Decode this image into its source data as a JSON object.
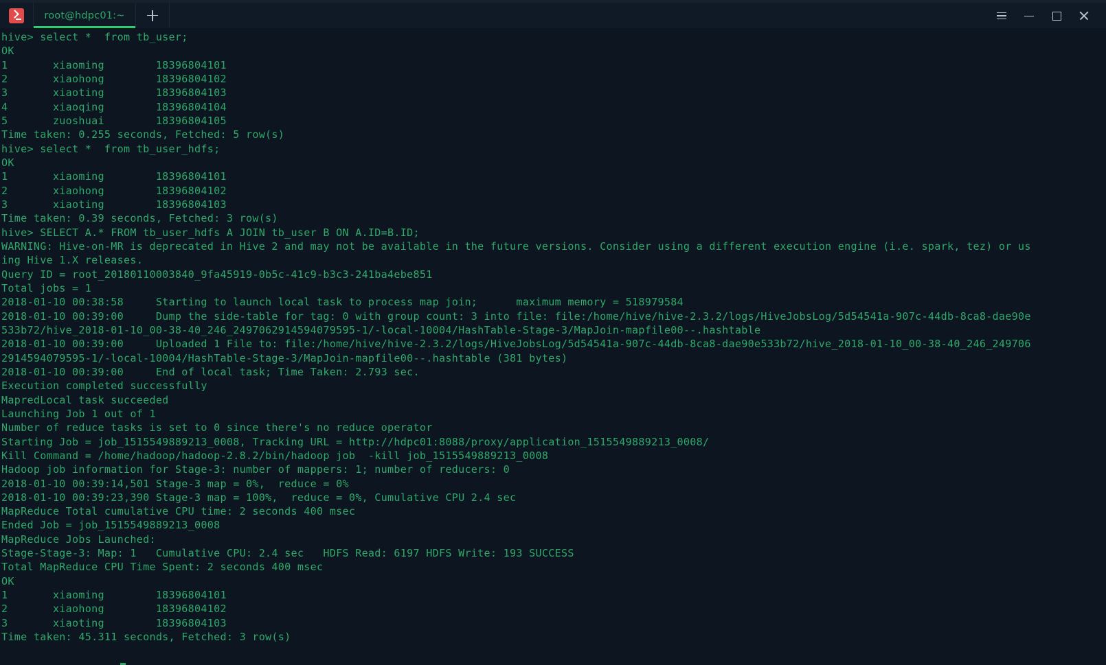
{
  "window": {
    "title": "root@hdpc01:~",
    "icon": "terminal-icon",
    "controls": {
      "menu_label": "☰",
      "minimize_label": "—",
      "maximize_label": "□",
      "close_label": "✕"
    },
    "new_tab_label": "+"
  },
  "tabs": [
    {
      "label": "root@hdpc01:~",
      "active": true
    }
  ],
  "colors": {
    "window_background": "#101a26",
    "terminal_background": "#0d1620",
    "terminal_foreground": "#2fa86a",
    "tab_active_underline": "#2ecc71",
    "tab_label": "#2fa86a",
    "icon_badge": "#e14b4b",
    "control_glyph": "#b9c3cc"
  },
  "terminal": {
    "prompt": "hive>",
    "cursor_visible": true,
    "lines": [
      "hive> select *  from tb_user;",
      "OK",
      "1       xiaoming        18396804101",
      "2       xiaohong        18396804102",
      "3       xiaoting        18396804103",
      "4       xiaoqing        18396804104",
      "5       zuoshuai        18396804105",
      "Time taken: 0.255 seconds, Fetched: 5 row(s)",
      "hive> select *  from tb_user_hdfs;",
      "OK",
      "1       xiaoming        18396804101",
      "2       xiaohong        18396804102",
      "3       xiaoting        18396804103",
      "Time taken: 0.39 seconds, Fetched: 3 row(s)",
      "hive> SELECT A.* FROM tb_user_hdfs A JOIN tb_user B ON A.ID=B.ID;",
      "WARNING: Hive-on-MR is deprecated in Hive 2 and may not be available in the future versions. Consider using a different execution engine (i.e. spark, tez) or us",
      "ing Hive 1.X releases.",
      "Query ID = root_20180110003840_9fa45919-0b5c-41c9-b3c3-241ba4ebe851",
      "Total jobs = 1",
      "2018-01-10 00:38:58     Starting to launch local task to process map join;      maximum memory = 518979584",
      "2018-01-10 00:39:00     Dump the side-table for tag: 0 with group count: 3 into file: file:/home/hive/hive-2.3.2/logs/HiveJobsLog/5d54541a-907c-44db-8ca8-dae90e",
      "533b72/hive_2018-01-10_00-38-40_246_2497062914594079595-1/-local-10004/HashTable-Stage-3/MapJoin-mapfile00--.hashtable",
      "2018-01-10 00:39:00     Uploaded 1 File to: file:/home/hive/hive-2.3.2/logs/HiveJobsLog/5d54541a-907c-44db-8ca8-dae90e533b72/hive_2018-01-10_00-38-40_246_249706",
      "2914594079595-1/-local-10004/HashTable-Stage-3/MapJoin-mapfile00--.hashtable (381 bytes)",
      "2018-01-10 00:39:00     End of local task; Time Taken: 2.793 sec.",
      "Execution completed successfully",
      "MapredLocal task succeeded",
      "Launching Job 1 out of 1",
      "Number of reduce tasks is set to 0 since there's no reduce operator",
      "Starting Job = job_1515549889213_0008, Tracking URL = http://hdpc01:8088/proxy/application_1515549889213_0008/",
      "Kill Command = /home/hadoop/hadoop-2.8.2/bin/hadoop job  -kill job_1515549889213_0008",
      "Hadoop job information for Stage-3: number of mappers: 1; number of reducers: 0",
      "2018-01-10 00:39:14,501 Stage-3 map = 0%,  reduce = 0%",
      "2018-01-10 00:39:23,390 Stage-3 map = 100%,  reduce = 0%, Cumulative CPU 2.4 sec",
      "MapReduce Total cumulative CPU time: 2 seconds 400 msec",
      "Ended Job = job_1515549889213_0008",
      "MapReduce Jobs Launched:",
      "Stage-Stage-3: Map: 1   Cumulative CPU: 2.4 sec   HDFS Read: 6197 HDFS Write: 193 SUCCESS",
      "Total MapReduce CPU Time Spent: 2 seconds 400 msec",
      "OK",
      "1       xiaoming        18396804101",
      "2       xiaohong        18396804102",
      "3       xiaoting        18396804103",
      "Time taken: 45.311 seconds, Fetched: 3 row(s)"
    ]
  }
}
